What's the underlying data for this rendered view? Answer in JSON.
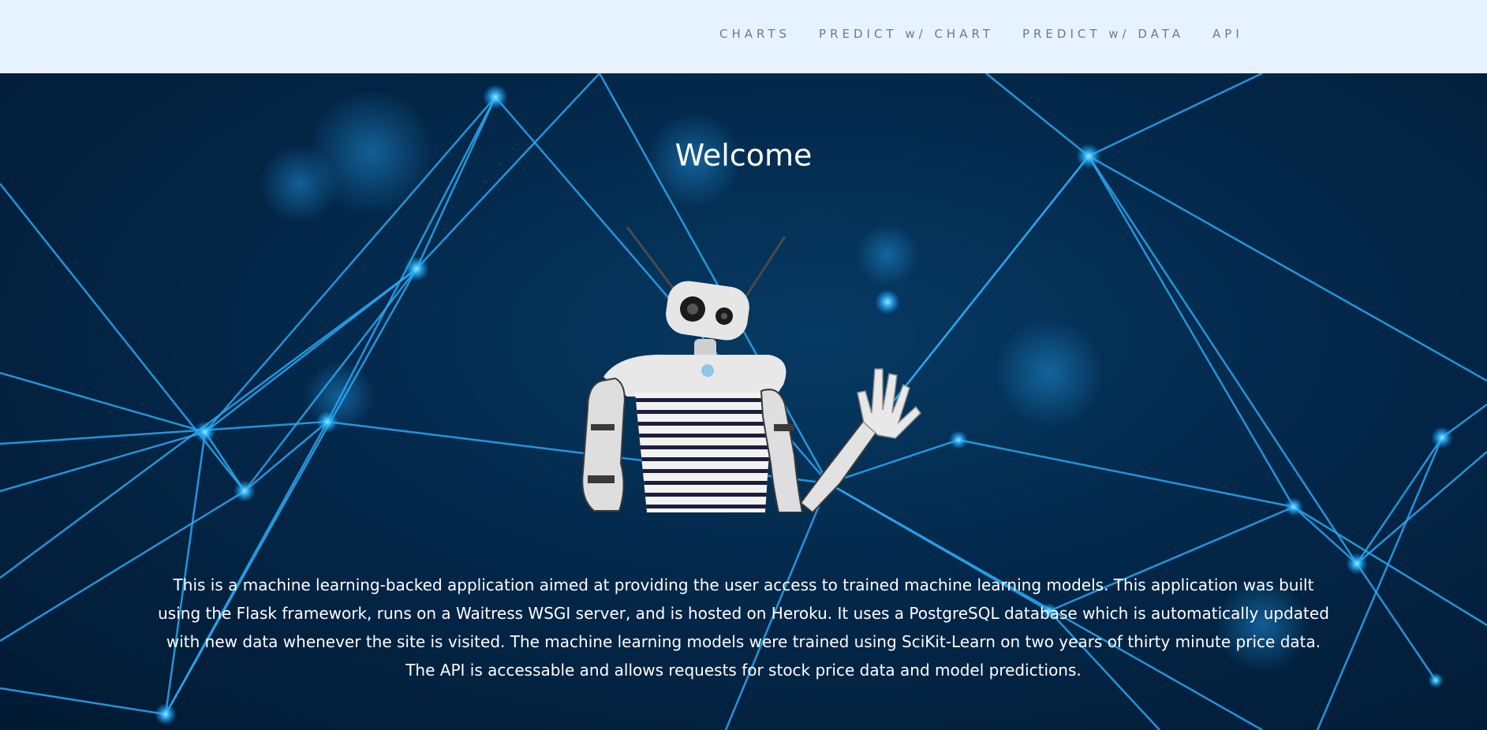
{
  "nav": {
    "items": [
      {
        "label": "CHARTS"
      },
      {
        "label": "PREDICT w/ CHART"
      },
      {
        "label": "PREDICT w/ DATA"
      },
      {
        "label": "API"
      }
    ]
  },
  "hero": {
    "title": "Welcome",
    "description": "This is a machine learning-backed application aimed at providing the user access to trained machine learning models. This application was built using the Flask framework, runs on a Waitress WSGI server, and is hosted on Heroku. It uses a PostgreSQL database which is automatically updated with new data whenever the site is visited. The machine learning models were trained using SciKit-Learn on two years of thirty minute price data. The API is accessable and allows requests for stock price data and model predictions."
  },
  "colors": {
    "navbar_bg": "#e6f2ff",
    "nav_text": "#6f7a80",
    "hero_bg": "#03284a",
    "network_line": "#1fa3f0",
    "text": "#ffffff"
  },
  "images": {
    "hero_background": "neural-network-background",
    "robot": "waving-robot"
  }
}
